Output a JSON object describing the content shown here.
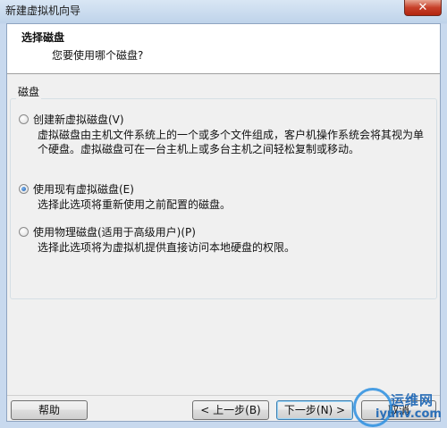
{
  "window": {
    "title": "新建虚拟机向导",
    "close_label": "✕"
  },
  "header": {
    "title": "选择磁盘",
    "subtitle": "您要使用哪个磁盘?"
  },
  "group": {
    "label": "磁盘"
  },
  "options": [
    {
      "label": "创建新虚拟磁盘(V)",
      "checked": false,
      "desc_lines": [
        "虚拟磁盘由主机文件系统上的一个或多个文件组成，客户机操作系统会将其视为单",
        "个硬盘。虚拟磁盘可在一台主机上或多台主机之间轻松复制或移动。"
      ]
    },
    {
      "label": "使用现有虚拟磁盘(E)",
      "checked": true,
      "desc_lines": [
        "选择此选项将重新使用之前配置的磁盘。"
      ]
    },
    {
      "label": "使用物理磁盘(适用于高级用户)(P)",
      "checked": false,
      "desc_lines": [
        "选择此选项将为虚拟机提供直接访问本地硬盘的权限。"
      ]
    }
  ],
  "buttons": {
    "help": "帮助",
    "back": "< 上一步(B)",
    "next": "下一步(N) >",
    "cancel": "取消"
  },
  "watermark": {
    "cn": "运维网",
    "en": "iyunv.com"
  }
}
